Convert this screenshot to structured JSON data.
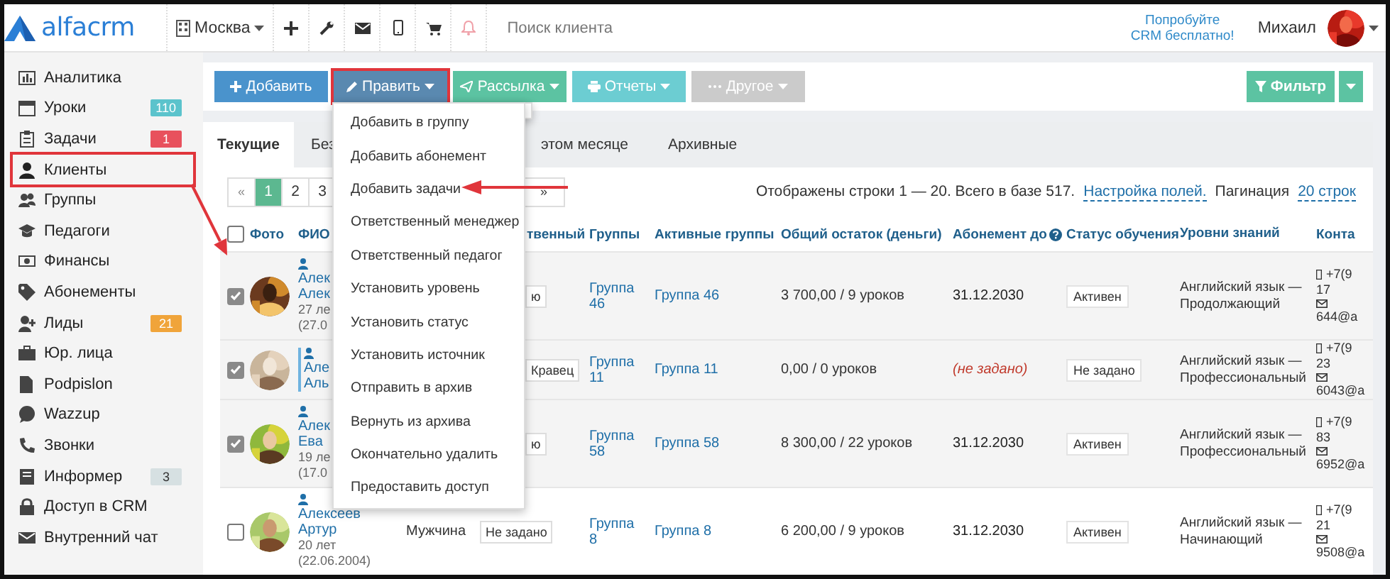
{
  "topbar": {
    "logo": "alfacrm",
    "city": "Москва",
    "search": {
      "placeholder": "Поиск клиента"
    },
    "promo": "Попробуйте CRM бесплатно!",
    "user": {
      "name": "Михаил",
      "avatar": {
        "kind": "picture"
      }
    }
  },
  "sidebar": {
    "items": [
      {
        "label": "Аналитика",
        "annotated": false
      },
      {
        "label": "Уроки",
        "annotated": false,
        "badge": {
          "text": "110",
          "color": "#5bc3cc"
        }
      },
      {
        "label": "Задачи",
        "annotated": false,
        "badge": {
          "text": "1",
          "color": "#e8515d"
        }
      },
      {
        "label": "Клиенты",
        "annotated": true
      },
      {
        "label": "Группы",
        "annotated": false
      },
      {
        "label": "Педагоги",
        "annotated": false
      },
      {
        "label": "Финансы",
        "annotated": false
      },
      {
        "label": "Абонементы",
        "annotated": false
      },
      {
        "label": "Лиды",
        "annotated": false,
        "badge": {
          "text": "21",
          "color": "#f0a43a"
        }
      },
      {
        "label": "Юр. лица",
        "annotated": false
      },
      {
        "label": "Podpislon",
        "annotated": false
      },
      {
        "label": "Wazzup",
        "annotated": false
      },
      {
        "label": "Звонки",
        "annotated": false
      },
      {
        "label": "Информер",
        "annotated": false,
        "badge": {
          "text": "3",
          "color": "#d6e0e2"
        }
      },
      {
        "label": "Доступ в CRM",
        "annotated": false
      },
      {
        "label": "Внутренний чат",
        "annotated": false
      }
    ]
  },
  "toolbar": {
    "buttons": [
      {
        "label": "Добавить",
        "color": "#4a93cc",
        "annotated": false,
        "dropdown": false
      },
      {
        "label": "Править",
        "color": "#5a89b0",
        "annotated": true,
        "dropdown": true
      },
      {
        "label": "Рассылка",
        "color": "#5cc3a2",
        "annotated": false,
        "dropdown": true
      },
      {
        "label": "Отчеты",
        "color": "#6ccdd2",
        "annotated": false,
        "dropdown": true
      },
      {
        "label": "Другое",
        "color": "#cbcbcb",
        "annotated": false,
        "dropdown": true
      }
    ],
    "filter": {
      "label": "Фильтр"
    }
  },
  "edit_menu": {
    "items": [
      "Добавить в группу",
      "Добавить абонемент",
      "Добавить задачи",
      "Ответственный менеджер",
      "Ответственный педагог",
      "Установить уровень",
      "Установить статус",
      "Установить источник",
      "Отправить в архив",
      "Вернуть из архива",
      "Окончательно удалить",
      "Предоставить доступ"
    ]
  },
  "tabs": [
    {
      "label": "Текущие",
      "selected": true
    },
    {
      "label": "Без",
      "selected": false
    },
    {
      "label": "этом месяце",
      "selected": false
    },
    {
      "label": "Архивные",
      "selected": false
    }
  ],
  "pagination": {
    "prev": "«",
    "pages": [
      {
        "label": "1",
        "selected": true
      },
      {
        "label": "2",
        "selected": false
      },
      {
        "label": "3",
        "selected": false
      }
    ],
    "next": "»"
  },
  "summary": {
    "text": "Отображены строки 1 — 20. Всего в базе 517.",
    "fields_link": "Настройка полей.",
    "pagination_label": "Пагинация",
    "page_size": "20 строк"
  },
  "table": {
    "select_all": {
      "checked": false
    },
    "columns": [
      {
        "label": "Фото"
      },
      {
        "label": "ФИО"
      },
      {
        "label": "твенный"
      },
      {
        "label": "Группы"
      },
      {
        "label": "Активные группы"
      },
      {
        "label": "Общий остаток (деньги)"
      },
      {
        "label": "Абонемент до",
        "help": true
      },
      {
        "label": "Статус обучения"
      },
      {
        "label": "Уровни знаний"
      },
      {
        "label": "Конта"
      }
    ],
    "rows": [
      {
        "checked": true,
        "flagged": false,
        "photo": {
          "kind": "picture"
        },
        "name": [
          "Алек",
          "Алек"
        ],
        "age": "27 ле",
        "birth": "(27.0",
        "manager": "ю",
        "groups": "Группа 46",
        "active_groups": "Группа 46",
        "balance": "3 700,00 / 9 уроков",
        "subscription": {
          "text": "31.12.2030",
          "set": true
        },
        "status": "Активен",
        "level": "Английский язык — Продолжающий",
        "contacts": {
          "phone": "+7(9",
          "phone_more": "17",
          "email": "644@a"
        }
      },
      {
        "checked": true,
        "flagged": true,
        "photo": {
          "kind": "picture"
        },
        "name": [
          "Але",
          "Аль"
        ],
        "manager": "Кравец",
        "groups": "Группа 11",
        "active_groups": "Группа 11",
        "balance": "0,00 / 0 уроков",
        "subscription": {
          "text": "(не задано)",
          "set": false
        },
        "status": "Не задано",
        "level": "Английский язык — Профессиональный",
        "contacts": {
          "phone": "+7(9",
          "phone_more": "23",
          "email": "6043@a"
        }
      },
      {
        "checked": true,
        "flagged": false,
        "photo": {
          "kind": "picture"
        },
        "name": [
          "Алек",
          "Ева"
        ],
        "age": "19 ле",
        "birth": "(17.0",
        "manager": "ю",
        "groups": "Группа 58",
        "active_groups": "Группа 58",
        "balance": "8 300,00 / 22 уроков",
        "subscription": {
          "text": "31.12.2030",
          "set": true
        },
        "status": "Активен",
        "level": "Английский язык — Профессиональный",
        "contacts": {
          "phone": "+7(9",
          "phone_more": "83",
          "email": "6952@a"
        }
      },
      {
        "checked": false,
        "flagged": false,
        "photo": {
          "kind": "picture"
        },
        "name": [
          "Алексеев",
          "Артур"
        ],
        "age": "20 лет",
        "birth": "(22.06.2004)",
        "gender": "Мужчина",
        "manager": "Не задано",
        "groups": "Группа 8",
        "active_groups": "Группа 8",
        "balance": "6 200,00 / 9 уроков",
        "subscription": {
          "text": "31.12.2030",
          "set": true
        },
        "status": "Активен",
        "level": "Английский язык — Начинающий",
        "contacts": {
          "phone": "+7(9",
          "phone_more": "21",
          "email": "9508@a"
        }
      }
    ]
  }
}
